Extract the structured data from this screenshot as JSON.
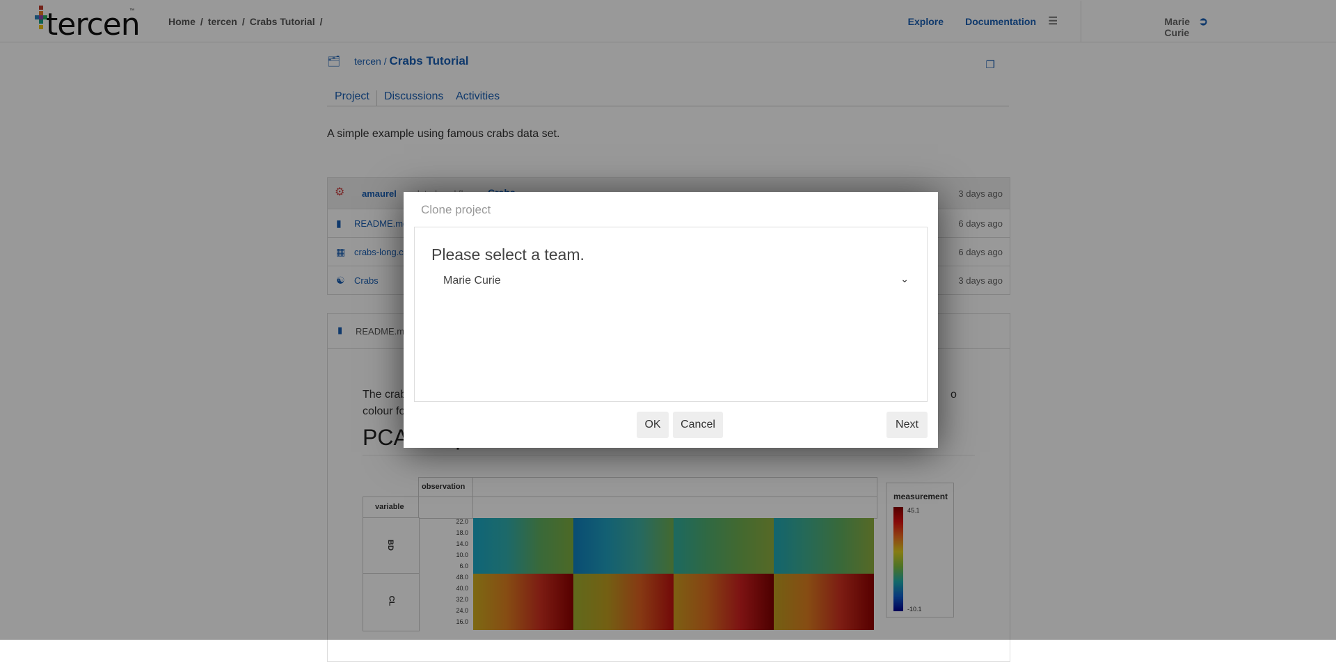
{
  "nav": {
    "logo_text": "tercen",
    "logo_tm": "™",
    "breadcrumbs": [
      "Home",
      "tercen",
      "Crabs Tutorial"
    ],
    "separator": "/",
    "explore": "Explore",
    "documentation": "Documentation",
    "user": "Marie Curie"
  },
  "project": {
    "owner": "tercen /",
    "title": "Crabs Tutorial",
    "tabs": [
      "Project",
      "Discussions",
      "Activities"
    ],
    "description": "A simple example using famous crabs data set."
  },
  "files": {
    "head": {
      "user": "amaurel",
      "action": "updated workflow",
      "target": "Crabs",
      "time": "3 days ago"
    },
    "rows": [
      {
        "name": "README.md",
        "time": "6 days ago",
        "icon": "file-icon"
      },
      {
        "name": "crabs-long.csv",
        "time": "6 days ago",
        "icon": "table-icon"
      },
      {
        "name": "Crabs",
        "time": "3 days ago",
        "icon": "workflow-icon"
      }
    ]
  },
  "readme": {
    "file": "README.md",
    "text_line1": "The crab",
    "text_line1_end": "o",
    "text_line2": "colour fo",
    "heading": "PCA computation"
  },
  "heatmap": {
    "col_header": "observation",
    "row_header": "variable",
    "rows": [
      "BD",
      "CL"
    ],
    "bd_ticks": [
      "22.0",
      "18.0",
      "14.0",
      "10.0",
      "6.0"
    ],
    "cl_ticks": [
      "48.0",
      "40.0",
      "32.0",
      "24.0",
      "16.0"
    ],
    "legend_title": "measurement",
    "legend_max": "45.1",
    "legend_min": "-10.1"
  },
  "modal": {
    "title": "Clone project",
    "question": "Please select a team.",
    "team_selected": "Marie Curie",
    "ok": "OK",
    "cancel": "Cancel",
    "next": "Next"
  }
}
